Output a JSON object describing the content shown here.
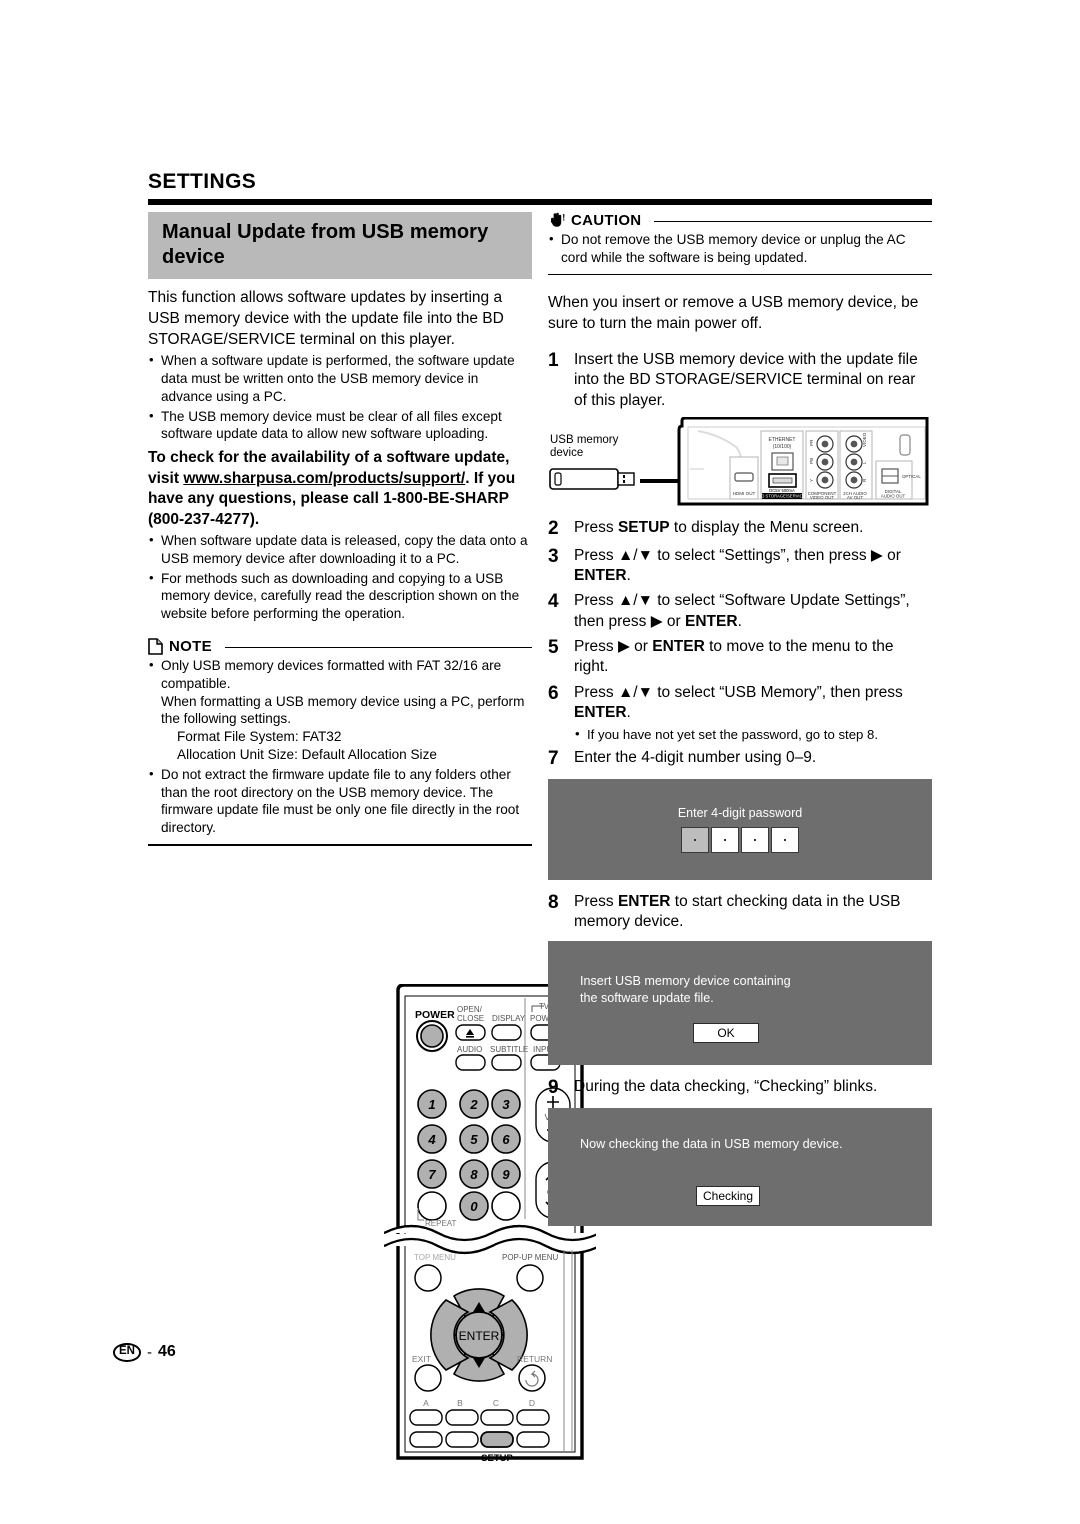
{
  "header": {
    "chapter": "SETTINGS"
  },
  "section": {
    "title": "Manual Update from USB memory device",
    "intro": "This function allows software updates by inserting a USB memory device with the update file into the BD STORAGE/SERVICE terminal on this player.",
    "intro_bullets": [
      "When a software update is performed, the software update data must be written onto the USB memory device in advance using a PC.",
      "The USB memory device must be clear of all files except software update data to allow new software uploading."
    ],
    "bold_lead": "To check for the availability of a software update, visit ",
    "bold_link": "www.sharpusa.com/products/support/",
    "bold_tail": ". If you have any questions, please call 1-800-BE-SHARP (800-237-4277).",
    "after_bullets": [
      "When software update data is released, copy the data onto a USB memory device after downloading it to a PC.",
      "For methods such as downloading and copying to a USB memory device, carefully read the description shown on the website before performing the operation."
    ]
  },
  "note": {
    "title": "NOTE",
    "icon": "document-icon",
    "items": [
      {
        "text": "Only USB memory devices formatted with FAT 32/16 are compatible.",
        "continuation": "When formatting a USB memory device using a PC, perform the following settings.",
        "indents": [
          "Format File System: FAT32",
          "Allocation Unit Size: Default Allocation Size"
        ]
      },
      {
        "text": "Do not extract the firmware update file to any folders other than the root directory on the USB memory device. The firmware update file must be only one file directly in the root directory.",
        "continuation": "",
        "indents": []
      }
    ]
  },
  "caution": {
    "title": "CAUTION",
    "icon": "hand-stop-icon",
    "items": [
      "Do not remove the USB memory device or unplug the AC cord while the software is being updated."
    ]
  },
  "right_intro": "When you insert or remove a USB memory device, be sure to turn the main power off.",
  "steps": [
    {
      "num": "1",
      "parts": [
        {
          "t": "Insert the USB memory device with the update file into the BD STORAGE/SERVICE terminal on rear of this player.",
          "b": false
        }
      ],
      "sub": []
    },
    {
      "num": "2",
      "parts": [
        {
          "t": "Press ",
          "b": false
        },
        {
          "t": "SETUP",
          "b": true
        },
        {
          "t": " to display the Menu screen.",
          "b": false
        }
      ],
      "sub": []
    },
    {
      "num": "3",
      "parts": [
        {
          "t": "Press ",
          "b": false
        },
        {
          "t": "▲/▼",
          "b": false
        },
        {
          "t": " to select “Settings”, then press ",
          "b": false
        },
        {
          "t": "▶",
          "b": false
        },
        {
          "t": " or ",
          "b": false
        },
        {
          "t": "ENTER",
          "b": true
        },
        {
          "t": ".",
          "b": false
        }
      ],
      "sub": []
    },
    {
      "num": "4",
      "parts": [
        {
          "t": "Press ",
          "b": false
        },
        {
          "t": "▲/▼",
          "b": false
        },
        {
          "t": " to select “Software Update Settings”, then press ",
          "b": false
        },
        {
          "t": "▶",
          "b": false
        },
        {
          "t": " or ",
          "b": false
        },
        {
          "t": "ENTER",
          "b": true
        },
        {
          "t": ".",
          "b": false
        }
      ],
      "sub": []
    },
    {
      "num": "5",
      "parts": [
        {
          "t": "Press ",
          "b": false
        },
        {
          "t": "▶",
          "b": false
        },
        {
          "t": " or ",
          "b": false
        },
        {
          "t": "ENTER",
          "b": true
        },
        {
          "t": " to move to the menu to the right.",
          "b": false
        }
      ],
      "sub": []
    },
    {
      "num": "6",
      "parts": [
        {
          "t": "Press ",
          "b": false
        },
        {
          "t": "▲/▼",
          "b": false
        },
        {
          "t": " to select “USB Memory”, then press ",
          "b": false
        },
        {
          "t": "ENTER",
          "b": true
        },
        {
          "t": ".",
          "b": false
        }
      ],
      "sub": [
        "If you have not yet set the password, go to step 8."
      ]
    },
    {
      "num": "7",
      "parts": [
        {
          "t": "Enter the 4-digit number using 0–9.",
          "b": false
        }
      ],
      "sub": []
    },
    {
      "num": "8",
      "parts": [
        {
          "t": "Press ",
          "b": false
        },
        {
          "t": "ENTER",
          "b": true
        },
        {
          "t": " to start checking data in the USB memory device.",
          "b": false
        }
      ],
      "sub": []
    },
    {
      "num": "9",
      "parts": [
        {
          "t": "During the data checking, “Checking” blinks.",
          "b": false
        }
      ],
      "sub": []
    }
  ],
  "osd": {
    "password": {
      "label": "Enter 4-digit password",
      "digits": [
        "·",
        "·",
        "·",
        "·"
      ],
      "selected_index": 0
    },
    "insert": {
      "line1": "Insert USB memory device containing",
      "line2": "the software update file.",
      "button": "OK"
    },
    "checking": {
      "line1": "Now checking the data in USB memory device.",
      "button": "Checking"
    }
  },
  "rear_figure": {
    "usb_label_line1": "USB memory",
    "usb_label_line2": "device",
    "ports": {
      "hdmi": "HDMI OUT",
      "ethernet_line1": "ETHERNET",
      "ethernet_line2": "(10/100)",
      "bd_storage_line1": "DC5V 500mA",
      "bd_storage_line2": "BD STORAGE/SERVICE",
      "component_line1": "COMPONENT",
      "component_line2": "VIDEO OUT",
      "component_y": "Y",
      "component_pb": "PB",
      "component_pr": "PR",
      "audio_line1": "2CH AUDIO",
      "audio_line2": "AV OUT",
      "audio_video": "VIDEO",
      "audio_l": "L",
      "audio_r": "R",
      "digital_line1": "DIGITAL",
      "digital_line2": "AUDIO OUT",
      "optical": "OPTICAL"
    }
  },
  "remote": {
    "labels": {
      "power": "POWER",
      "open_close_line1": "OPEN/",
      "open_close_line2": "CLOSE",
      "display": "DISPLAY",
      "tv": "TV",
      "tv_power": "POWER",
      "audio": "AUDIO",
      "subtitle": "SUBTITLE",
      "input": "INPUT",
      "vol": "VOL",
      "ch": "CH",
      "repeat": "REPEAT",
      "popup_menu": "POP-UP MENU",
      "enter": "ENTER",
      "exit": "EXIT",
      "return": "RETURN",
      "setup": "SETUP",
      "a": "A",
      "b": "B",
      "c": "C",
      "d": "D"
    },
    "numbers": [
      "1",
      "2",
      "3",
      "4",
      "5",
      "6",
      "7",
      "8",
      "9",
      "0"
    ]
  },
  "footer": {
    "lang": "EN",
    "dash": "-",
    "page": "46"
  },
  "colors": {
    "title_band": "#b9b9b9",
    "osd_bg": "#6e6e6e",
    "button_gray": "#b0b0b0",
    "rule": "#000000"
  }
}
